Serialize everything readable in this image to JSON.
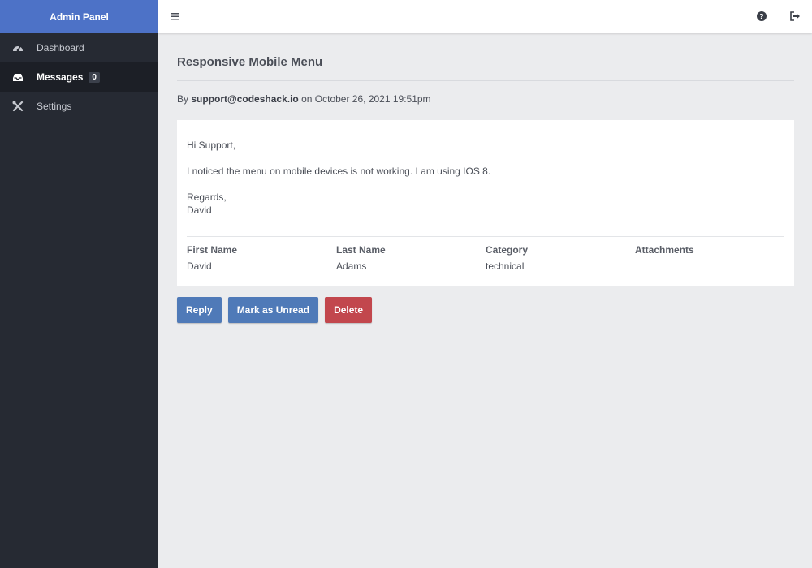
{
  "brand": "Admin Panel",
  "colors": {
    "brand": "#4d72c7",
    "sidebar": "#262a33",
    "primary_button": "#4f7ab8",
    "danger_button": "#c2474d"
  },
  "sidebar": {
    "items": [
      {
        "label": "Dashboard",
        "icon": "gauge-icon"
      },
      {
        "label": "Messages",
        "icon": "inbox-icon",
        "badge": "0",
        "active": true
      },
      {
        "label": "Settings",
        "icon": "tools-icon"
      }
    ]
  },
  "topbar": {
    "icons": [
      "menu-icon",
      "help-icon",
      "logout-icon"
    ]
  },
  "message": {
    "title": "Responsive Mobile Menu",
    "meta": {
      "prefix": "By",
      "email": "support@codeshack.io",
      "date_text": "on October 26, 2021 19:51pm"
    },
    "body": {
      "greeting": "Hi Support,",
      "text": "I noticed the menu on mobile devices is not working. I am using IOS 8.",
      "signoff": "Regards,",
      "signature": "David"
    },
    "fields": [
      {
        "label": "First Name",
        "value": "David"
      },
      {
        "label": "Last Name",
        "value": "Adams"
      },
      {
        "label": "Category",
        "value": "technical"
      },
      {
        "label": "Attachments",
        "value": ""
      }
    ]
  },
  "actions": {
    "reply": "Reply",
    "mark_unread": "Mark as Unread",
    "delete": "Delete"
  }
}
